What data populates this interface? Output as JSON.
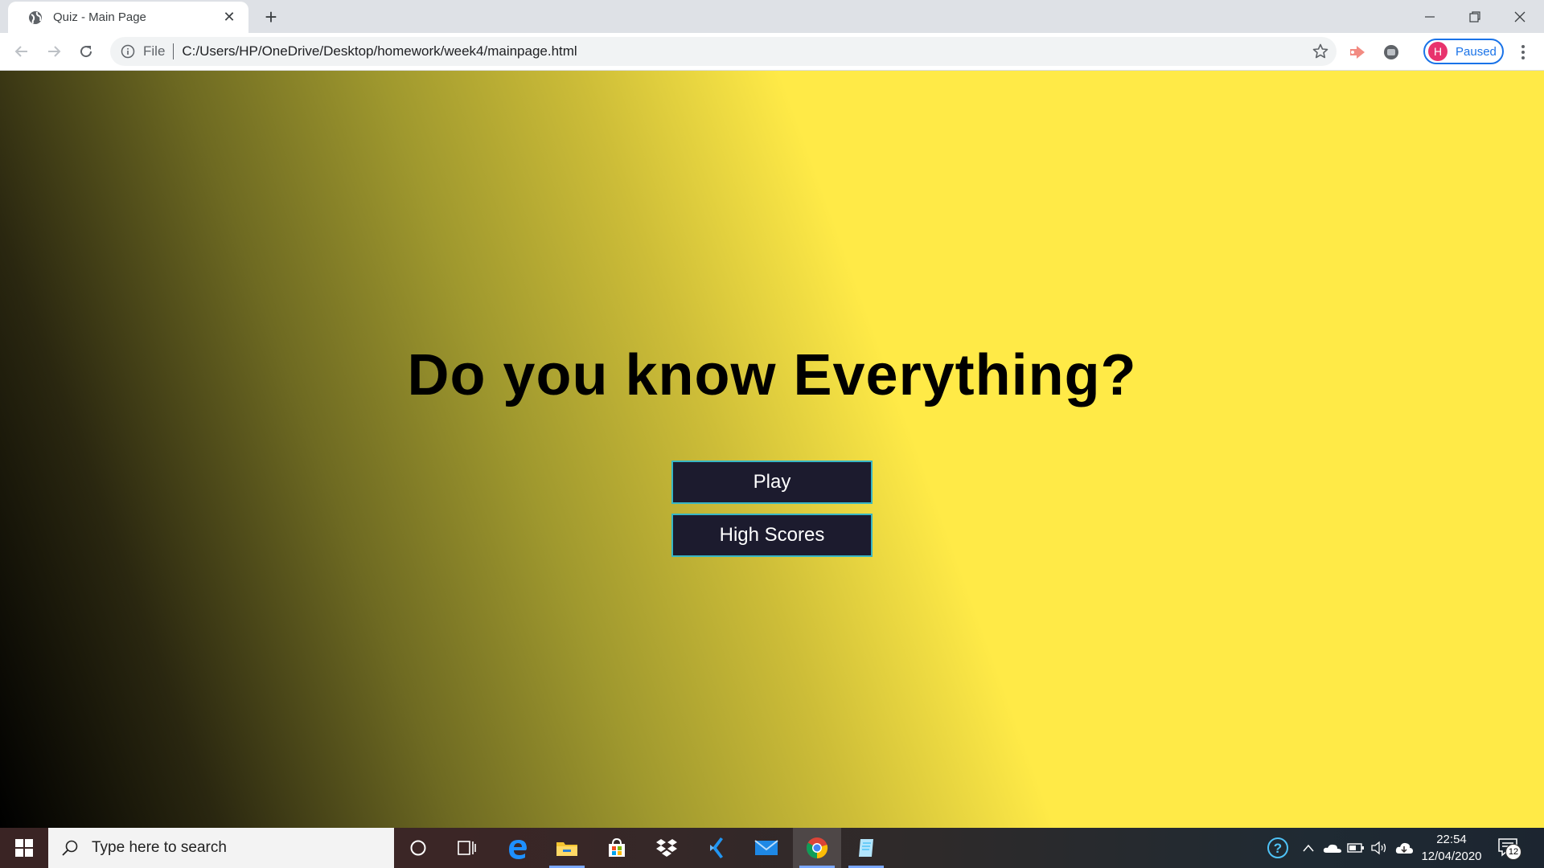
{
  "browser": {
    "tab_title": "Quiz - Main Page",
    "new_tab_label": "+",
    "address_scheme_label": "File",
    "address_url": "C:/Users/HP/OneDrive/Desktop/homework/week4/mainpage.html",
    "profile_initial": "H",
    "profile_status": "Paused",
    "profile_color": "#e8336d",
    "accent_color": "#1a73e8"
  },
  "page": {
    "headline": "Do you know Everything?",
    "buttons": {
      "play": "Play",
      "high_scores": "High Scores"
    },
    "button_bg": "#1c1b2e",
    "button_border": "#38b6c4",
    "gradient_colors": [
      "#000000",
      "#6e6a22",
      "#ffea47"
    ]
  },
  "taskbar": {
    "search_placeholder": "Type here to search",
    "clock_time": "22:54",
    "clock_date": "12/04/2020",
    "notification_count": "12",
    "apps": [
      "cortana-icon",
      "task-view-icon",
      "edge-icon",
      "file-explorer-icon",
      "store-icon",
      "dropbox-icon",
      "vscode-icon",
      "mail-icon",
      "chrome-icon",
      "notepad-icon"
    ]
  }
}
